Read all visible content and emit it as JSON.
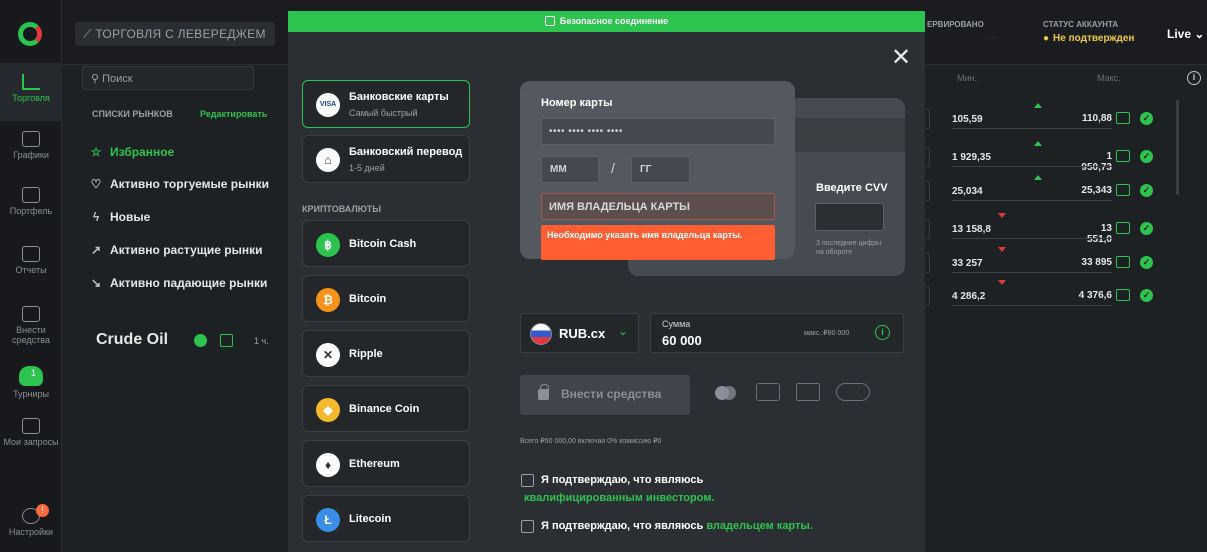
{
  "rail": {
    "items": [
      {
        "label": "Торговля"
      },
      {
        "label": "Графики"
      },
      {
        "label": "Портфель"
      },
      {
        "label": "Отчеты"
      },
      {
        "label": "Внести средства"
      },
      {
        "label": "Турниры",
        "badge": "1"
      },
      {
        "label": "Мои запросы"
      },
      {
        "label": "Настройки",
        "badge": "!"
      }
    ]
  },
  "topbar": {
    "leverage_label": "ТОРГОВЛЯ С ЛЕВЕРЕДЖЕМ",
    "reserved_label": "ЕРВИРОВАНО",
    "reserved_value": "...",
    "account_status_label": "СТАТУС АККАУНТА",
    "account_status_value": "Не подтвержден",
    "mode": "Live",
    "status_color": "#ecc94b"
  },
  "markets": {
    "search_placeholder": "Поиск",
    "lists_header": "СПИСКИ РЫНКОВ",
    "edit_label": "Редактировать",
    "lists": [
      {
        "label": "Избранное",
        "icon": "star-icon"
      },
      {
        "label": "Активно торгуемые рынки",
        "icon": "heart-icon"
      },
      {
        "label": "Новые",
        "icon": "lightning-icon"
      },
      {
        "label": "Активно растущие рынки",
        "icon": "trend-up-icon"
      },
      {
        "label": "Активно падающие рынки",
        "icon": "trend-down-icon"
      }
    ],
    "selected_instrument": "Crude Oil",
    "timeframe": "1 ч."
  },
  "prices": {
    "col_min": "Мин.",
    "col_max": "Макс.",
    "rows": [
      {
        "min": "105,59",
        "max": "110,88",
        "trend": "up"
      },
      {
        "min": "1 929,35",
        "max": "1 950,73",
        "trend": "up"
      },
      {
        "min": "25,034",
        "max": "25,343",
        "trend": "up"
      },
      {
        "min": "13 158,8",
        "max": "13 551,0",
        "trend": "down"
      },
      {
        "min": "33 257",
        "max": "33 895",
        "trend": "down"
      },
      {
        "min": "4 286,2",
        "max": "4 376,6",
        "trend": "down"
      }
    ]
  },
  "modal": {
    "secure_label": "Безопасное соединение",
    "methods": [
      {
        "title": "Банковские карты",
        "subtitle": "Самый быстрый",
        "icon": "visa-mastercard-icon"
      },
      {
        "title": "Банковский перевод",
        "subtitle": "1-5 дней",
        "icon": "bank-icon"
      }
    ],
    "crypto_header": "КРИПТОВАЛЮТЫ",
    "crypto": [
      {
        "title": "Bitcoin Cash",
        "icon": "bitcoin-cash-icon",
        "color": "#2dc34f",
        "glyph": "฿"
      },
      {
        "title": "Bitcoin",
        "icon": "bitcoin-icon",
        "color": "#f7931a",
        "glyph": "₿"
      },
      {
        "title": "Ripple",
        "icon": "ripple-icon",
        "color": "#ffffff",
        "glyph": "✕"
      },
      {
        "title": "Binance Coin",
        "icon": "binance-icon",
        "color": "#f3ba2f",
        "glyph": "◆"
      },
      {
        "title": "Ethereum",
        "icon": "ethereum-icon",
        "color": "#ffffff",
        "glyph": "♦"
      },
      {
        "title": "Litecoin",
        "icon": "litecoin-icon",
        "color": "#3a8ee6",
        "glyph": "Ł"
      }
    ],
    "card": {
      "number_label": "Номер карты",
      "number_placeholder": "•••• •••• •••• ••••",
      "mm_placeholder": "ММ",
      "yy_placeholder": "ГГ",
      "holder_placeholder": "ИМЯ ВЛАДЕЛЬЦА КАРТЫ",
      "holder_error": "Необходимо указать имя владельца карты.",
      "cvv_label": "Введите CVV",
      "cvv_hint": "3 последние цифры на обороте"
    },
    "currency": "RUB.cx",
    "amount_label": "Сумма",
    "amount_value": "60 000",
    "amount_max": "макс.:₽80 000",
    "deposit_button": "Внести средства",
    "summary": "Всего ₽60 000,00 включая 0% комиссию ₽0",
    "confirm_investor_prefix": "Я подтверждаю, что являюсь",
    "confirm_investor_link": "квалифицированным инвестором.",
    "confirm_owner_prefix": "Я подтверждаю, что являюсь",
    "confirm_owner_link": "владельцем карты.",
    "accent_color": "#2dc34f",
    "error_color": "#ff5e33"
  }
}
